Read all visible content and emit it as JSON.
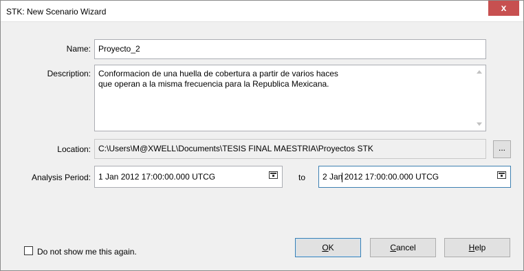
{
  "window": {
    "title": "STK: New Scenario Wizard",
    "close_glyph": "x"
  },
  "form": {
    "name_label": "Name:",
    "name_value": "Proyecto_2",
    "description_label": "Description:",
    "description_value": "Conformacion de una huella de cobertura a partir de varios haces\nque operan a la misma frecuencia para la Republica Mexicana.",
    "location_label": "Location:",
    "location_value": "C:\\Users\\M@XWELL\\Documents\\TESIS FINAL MAESTRIA\\Proyectos STK",
    "browse_label": "...",
    "analysis_label": "Analysis Period:",
    "start_value": "1 Jan 2012 17:00:00.000 UTCG",
    "to_label": "to",
    "stop_value_before_caret": "2 Jan",
    "stop_value_after_caret": " 2012 17:00:00.000 UTCG"
  },
  "footer": {
    "checkbox_label": "Do not show me this again.",
    "checkbox_checked": false,
    "ok_mnemonic": "O",
    "ok_rest": "K",
    "cancel_mnemonic": "C",
    "cancel_rest": "ancel",
    "help_mnemonic": "H",
    "help_rest": "elp"
  }
}
